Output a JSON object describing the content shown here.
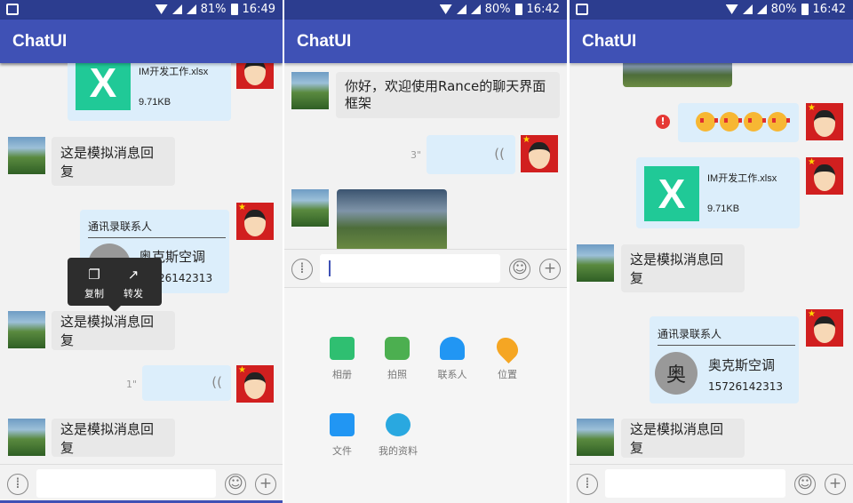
{
  "screens": [
    {
      "status": {
        "battery": "81%",
        "time": "16:49"
      },
      "title": "ChatUI"
    },
    {
      "status": {
        "battery": "80%",
        "time": "16:42"
      },
      "title": "ChatUI"
    },
    {
      "status": {
        "battery": "80%",
        "time": "16:42"
      },
      "title": "ChatUI"
    }
  ],
  "messages": {
    "file_name": "IM开发工作.xlsx",
    "file_size": "9.71KB",
    "reply_text": "这是模拟消息回复",
    "welcome_text": "你好，欢迎使用Rance的聊天界面框架",
    "contact_card_title": "通讯录联系人",
    "contact_avatar": "奥",
    "contact_name": "奥克斯空调",
    "contact_phone": "15726142313",
    "contact_phone_partial": "26142313",
    "voice_duration_1": "1\"",
    "voice_duration_3": "3\""
  },
  "popup_menu": {
    "copy": "复制",
    "forward": "转发"
  },
  "plus_panel": {
    "album": "相册",
    "camera": "拍照",
    "contacts": "联系人",
    "location": "位置",
    "file": "文件",
    "my_profile": "我的资料"
  },
  "colors": {
    "status_bar": "#2c3d8f",
    "app_bar": "#3f51b5",
    "bubble_right": "#dceefb",
    "bubble_left": "#e8e8e8",
    "file_icon": "#20c997"
  }
}
